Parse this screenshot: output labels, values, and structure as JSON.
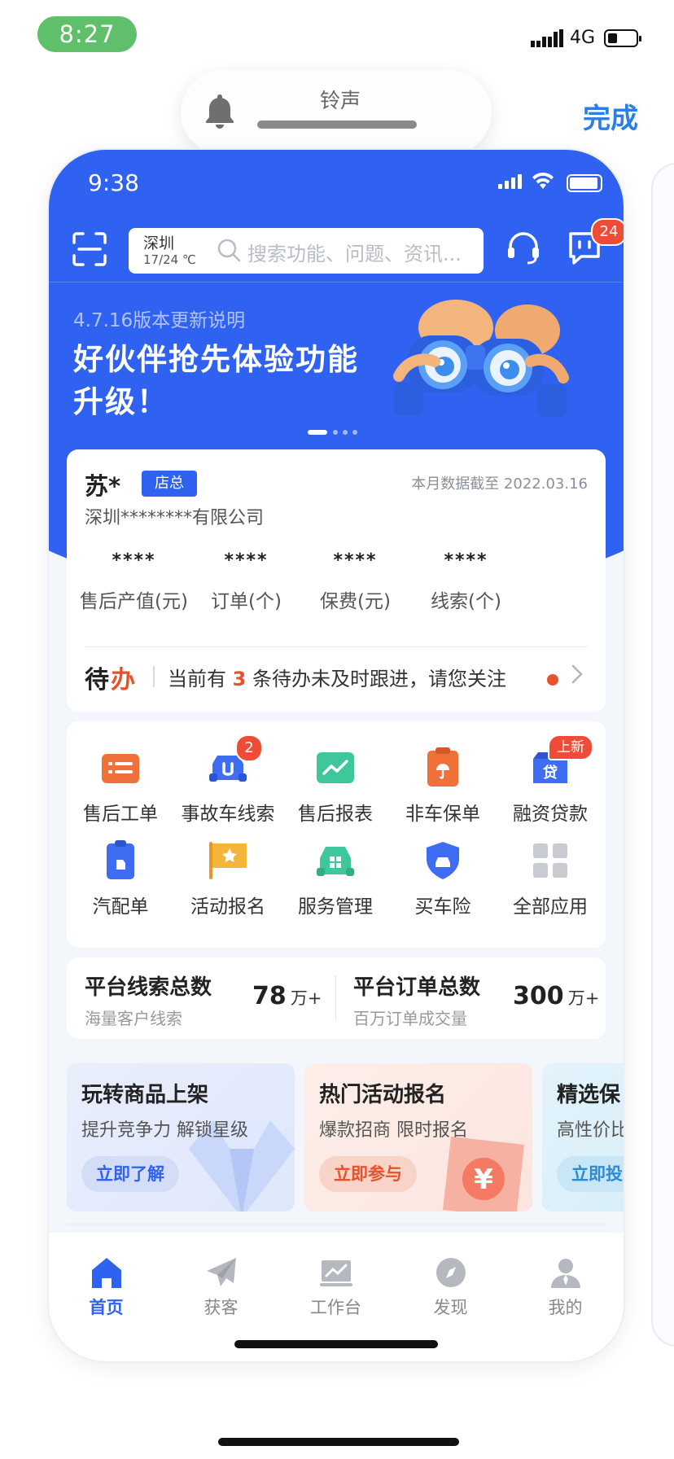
{
  "outer_status": {
    "time": "8:27",
    "network": "4G"
  },
  "ringtone": {
    "label": "铃声",
    "done": "完成"
  },
  "phone_status": {
    "time": "9:38"
  },
  "header": {
    "city": "深圳",
    "temperature": "17/24 ℃",
    "search_placeholder": "搜索功能、问题、资讯...",
    "message_badge": "24"
  },
  "banner": {
    "subtitle": "4.7.16版本更新说明",
    "title": "好伙伴抢先体验功能升级！"
  },
  "account": {
    "name": "苏*",
    "role": "店总",
    "data_date": "本月数据截至 2022.03.16",
    "company": "深圳********有限公司",
    "stats": [
      {
        "value": "****",
        "label": "售后产值(元)"
      },
      {
        "value": "****",
        "label": "订单(个)"
      },
      {
        "value": "****",
        "label": "保费(元)"
      },
      {
        "value": "****",
        "label": "线索(个)"
      }
    ],
    "todo": {
      "label_a": "待",
      "label_b": "办",
      "text_before": "当前有 ",
      "count": "3",
      "text_after": " 条待办未及时跟进，请您关注"
    }
  },
  "apps": [
    {
      "label": "售后工单",
      "icon": "work-order-icon",
      "color": "#f0703a"
    },
    {
      "label": "事故车线索",
      "icon": "accident-car-icon",
      "color": "#3f6df2",
      "badge": "2"
    },
    {
      "label": "售后报表",
      "icon": "report-chart-icon",
      "color": "#3ec79a"
    },
    {
      "label": "非车保单",
      "icon": "non-car-policy-icon",
      "color": "#f0703a"
    },
    {
      "label": "融资贷款",
      "icon": "loan-icon",
      "color": "#3f6df2",
      "badge_new": "上新"
    },
    {
      "label": "汽配单",
      "icon": "auto-parts-icon",
      "color": "#3f6df2"
    },
    {
      "label": "活动报名",
      "icon": "activity-flag-icon",
      "color": "#f3b63a"
    },
    {
      "label": "服务管理",
      "icon": "service-manage-icon",
      "color": "#3ec79a"
    },
    {
      "label": "买车险",
      "icon": "car-insurance-icon",
      "color": "#3f6df2"
    },
    {
      "label": "全部应用",
      "icon": "all-apps-icon",
      "color": "#c8cbd2"
    }
  ],
  "platform": {
    "leads_title": "平台线索总数",
    "leads_sub": "海量客户线索",
    "leads_value": "78",
    "leads_unit": "万+",
    "orders_title": "平台订单总数",
    "orders_sub": "百万订单成交量",
    "orders_value": "300",
    "orders_unit": "万+"
  },
  "promos": [
    {
      "title": "玩转商品上架",
      "subtitle": "提升竞争力 解锁星级",
      "button": "立即了解"
    },
    {
      "title": "热门活动报名",
      "subtitle": "爆款招商 限时报名",
      "button": "立即参与"
    },
    {
      "title": "精选保",
      "subtitle": "高性价比",
      "button": "立即投"
    }
  ],
  "tabs": [
    {
      "label": "首页",
      "active": true
    },
    {
      "label": "获客"
    },
    {
      "label": "工作台"
    },
    {
      "label": "发现"
    },
    {
      "label": "我的"
    }
  ],
  "colors": {
    "brand": "#2f62f0",
    "accent": "#e8512c"
  }
}
